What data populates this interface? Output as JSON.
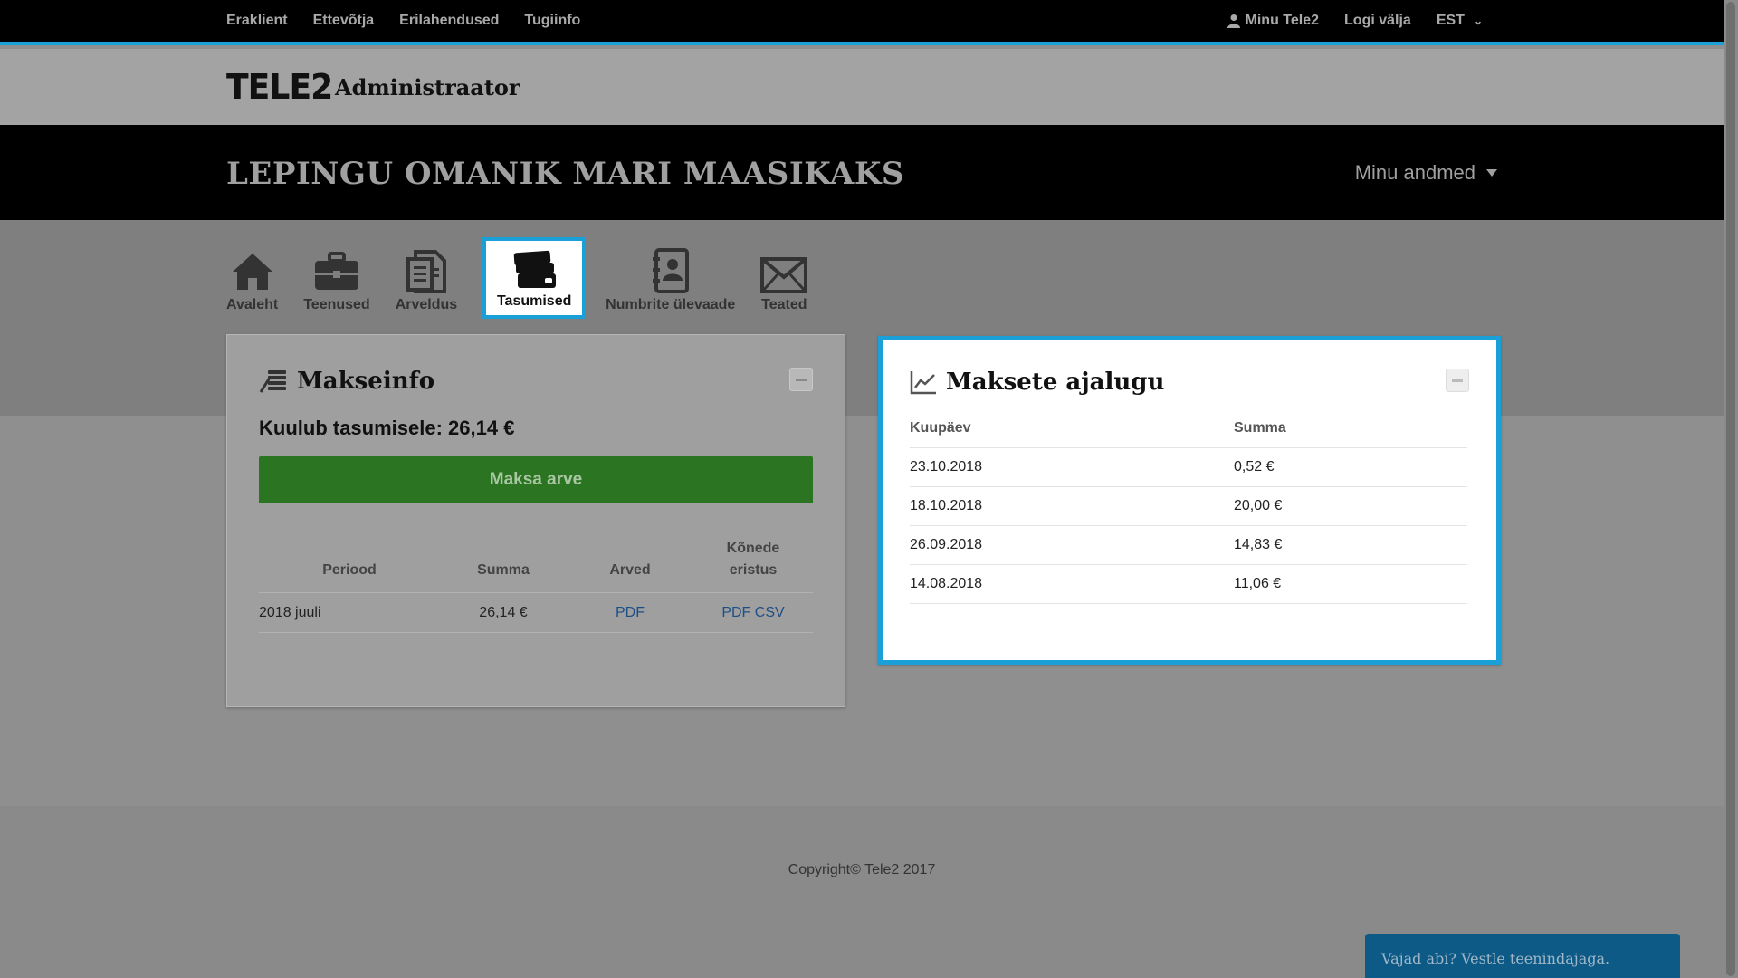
{
  "topnav": {
    "left_links": [
      "Eraklient",
      "Ettevõtja",
      "Erilahendused",
      "Tugiinfo"
    ],
    "user_link": "Minu Tele2",
    "logout": "Logi välja",
    "language": "EST"
  },
  "brand": {
    "logo": "TELE2",
    "role": "Administraator"
  },
  "banner": {
    "title": "LEPINGU OMANIK MARI MAASIKAKS",
    "menu": "Minu andmed"
  },
  "icon_nav": [
    {
      "label": "Avaleht",
      "icon": "home-icon"
    },
    {
      "label": "Teenused",
      "icon": "briefcase-icon"
    },
    {
      "label": "Arveldus",
      "icon": "invoice-icon"
    },
    {
      "label": "Tasumised",
      "icon": "cards-icon",
      "active": true
    },
    {
      "label": "Numbrite ülevaade",
      "icon": "contacts-icon"
    },
    {
      "label": "Teated",
      "icon": "envelope-icon"
    }
  ],
  "makseinfo": {
    "title": "Makseinfo",
    "due": "Kuulub tasumisele: 26,14 €",
    "pay_button": "Maksa arve",
    "columns": [
      "Periood",
      "Summa",
      "Arved",
      "Kõnede eristus"
    ],
    "rows": [
      {
        "period": "2018 juuli",
        "sum": "26,14 €",
        "invoice": "PDF",
        "pdf": "PDF",
        "csv": "CSV"
      }
    ]
  },
  "history": {
    "title": "Maksete ajalugu",
    "columns": [
      "Kuupäev",
      "Summa"
    ],
    "rows": [
      {
        "date": "23.10.2018",
        "sum": "0,52 €"
      },
      {
        "date": "18.10.2018",
        "sum": "20,00 €"
      },
      {
        "date": "26.09.2018",
        "sum": "14,83 €"
      },
      {
        "date": "14.08.2018",
        "sum": "11,06 €"
      }
    ]
  },
  "footer": {
    "copyright": "Copyright© Tele2 2017"
  },
  "chat": {
    "label": "Vajad abi? Vestle teenindajaga."
  },
  "colors": {
    "accent": "#1aa0d8",
    "pay_button": "#2b7421",
    "link": "#1d4f86"
  }
}
